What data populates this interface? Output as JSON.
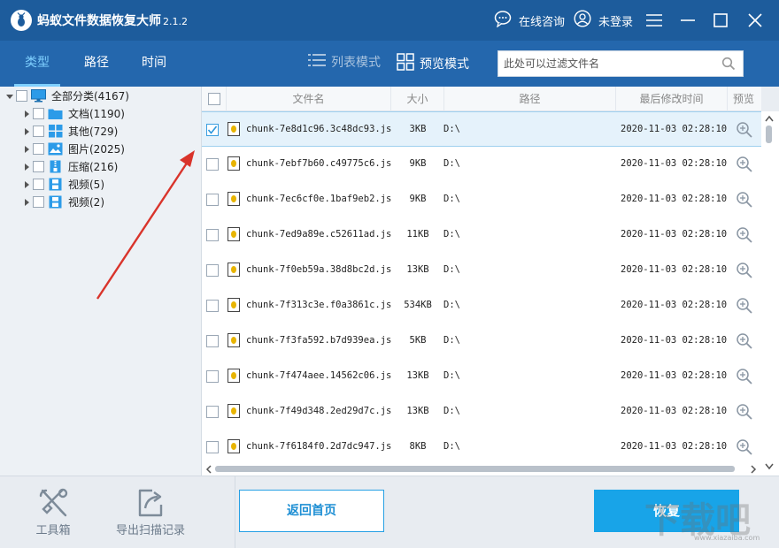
{
  "app": {
    "title": "蚂蚁文件数据恢复大师",
    "version": "2.1.2"
  },
  "titlebar": {
    "consult": "在线咨询",
    "login": "未登录"
  },
  "tabs": [
    {
      "label": "类型",
      "active": true
    },
    {
      "label": "路径",
      "active": false
    },
    {
      "label": "时间",
      "active": false
    }
  ],
  "view_modes": {
    "list": "列表模式",
    "preview": "预览模式"
  },
  "search": {
    "placeholder": "此处可以过滤文件名"
  },
  "tree": {
    "root": "全部分类(4167)",
    "items": [
      {
        "label": "文档(1190)",
        "icon": "folder-icon"
      },
      {
        "label": "其他(729)",
        "icon": "grid-icon"
      },
      {
        "label": "图片(2025)",
        "icon": "image-icon"
      },
      {
        "label": "压缩(216)",
        "icon": "zip-icon"
      },
      {
        "label": "视频(5)",
        "icon": "film-icon"
      },
      {
        "label": "视频(2)",
        "icon": "film-icon"
      }
    ]
  },
  "columns": {
    "name": "文件名",
    "size": "大小",
    "path": "路径",
    "mtime": "最后修改时间",
    "preview": "预览"
  },
  "files": [
    {
      "name": "chunk-7e8d1c96.3c48dc93.js",
      "size": "3KB",
      "path": "D:\\",
      "mtime": "2020-11-03 02:28:10",
      "checked": true
    },
    {
      "name": "chunk-7ebf7b60.c49775c6.js",
      "size": "9KB",
      "path": "D:\\",
      "mtime": "2020-11-03 02:28:10",
      "checked": false
    },
    {
      "name": "chunk-7ec6cf0e.1baf9eb2.js",
      "size": "9KB",
      "path": "D:\\",
      "mtime": "2020-11-03 02:28:10",
      "checked": false
    },
    {
      "name": "chunk-7ed9a89e.c52611ad.js",
      "size": "11KB",
      "path": "D:\\",
      "mtime": "2020-11-03 02:28:10",
      "checked": false
    },
    {
      "name": "chunk-7f0eb59a.38d8bc2d.js",
      "size": "13KB",
      "path": "D:\\",
      "mtime": "2020-11-03 02:28:10",
      "checked": false
    },
    {
      "name": "chunk-7f313c3e.f0a3861c.js",
      "size": "534KB",
      "path": "D:\\",
      "mtime": "2020-11-03 02:28:10",
      "checked": false
    },
    {
      "name": "chunk-7f3fa592.b7d939ea.js",
      "size": "5KB",
      "path": "D:\\",
      "mtime": "2020-11-03 02:28:10",
      "checked": false
    },
    {
      "name": "chunk-7f474aee.14562c06.js",
      "size": "13KB",
      "path": "D:\\",
      "mtime": "2020-11-03 02:28:10",
      "checked": false
    },
    {
      "name": "chunk-7f49d348.2ed29d7c.js",
      "size": "13KB",
      "path": "D:\\",
      "mtime": "2020-11-03 02:28:10",
      "checked": false
    },
    {
      "name": "chunk-7f6184f0.2d7dc947.js",
      "size": "8KB",
      "path": "D:\\",
      "mtime": "2020-11-03 02:28:10",
      "checked": false
    }
  ],
  "bottom": {
    "toolbox": "工具箱",
    "export": "导出扫描记录",
    "home": "返回首页",
    "recover": "恢复"
  },
  "watermark": {
    "text": "下载吧",
    "url": "www.xiazaiba.com"
  },
  "colors": {
    "titlebar": "#1d5c9c",
    "navbar": "#2467ad",
    "accent": "#18a4e8",
    "active_tab": "#7fd0ff",
    "annotation_arrow": "#d9342b"
  }
}
